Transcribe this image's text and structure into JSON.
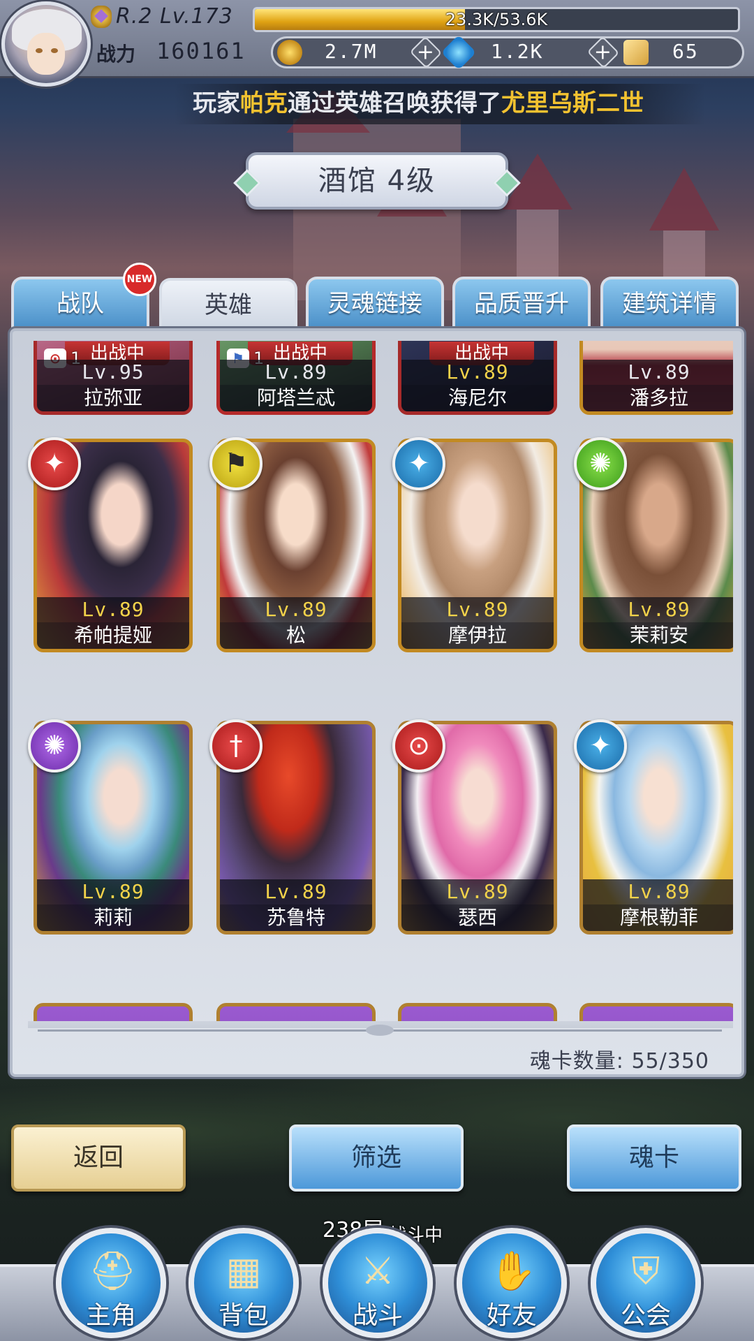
{
  "player": {
    "level_text": "R.2 Lv.173",
    "exp": {
      "current": "23.3K",
      "max": "53.6K",
      "text": "23.3K/53.6K",
      "fraction": 0.435
    },
    "power_label": "战力",
    "power_value": "160161"
  },
  "resources": {
    "gold": "2.7M",
    "diamond": "1.2K",
    "ticket": "65",
    "plus": "+"
  },
  "broadcast": {
    "part1": "玩家",
    "player_name": "帕克",
    "part2": "通过英雄召唤获得了",
    "hero_name": "尤里乌斯二世"
  },
  "building_title": "酒馆 4级",
  "tabs": [
    {
      "label": "战队",
      "badge": "NEW"
    },
    {
      "label": "英雄"
    },
    {
      "label": "灵魂链接"
    },
    {
      "label": "品质晋升"
    },
    {
      "label": "建筑详情"
    }
  ],
  "deployed_label": "出战中",
  "cards_row0": [
    {
      "name": "拉弥亚",
      "level": "Lv.95",
      "count": "1",
      "deployed": true
    },
    {
      "name": "阿塔兰忒",
      "level": "Lv.89",
      "count": "1",
      "deployed": true
    },
    {
      "name": "海尼尔",
      "level": "Lv.89",
      "deployed": true
    },
    {
      "name": "潘多拉",
      "level": "Lv.89"
    }
  ],
  "cards_row1": [
    {
      "name": "希帕提娅",
      "level": "Lv.89",
      "element": "wing-icon"
    },
    {
      "name": "松",
      "level": "Lv.89",
      "element": "banner-icon"
    },
    {
      "name": "摩伊拉",
      "level": "Lv.89",
      "element": "wing-icon"
    },
    {
      "name": "茉莉安",
      "level": "Lv.89",
      "element": "shuriken-icon"
    }
  ],
  "cards_row2": [
    {
      "name": "莉莉",
      "level": "Lv.89",
      "element": "shuriken-icon"
    },
    {
      "name": "苏鲁特",
      "level": "Lv.89",
      "element": "dagger-icon"
    },
    {
      "name": "瑟西",
      "level": "Lv.89",
      "element": "staff-icon"
    },
    {
      "name": "摩根勒菲",
      "level": "Lv.89",
      "element": "wing-icon"
    }
  ],
  "soul_card_count": "魂卡数量: 55/350",
  "buttons": {
    "back": "返回",
    "filter": "筛选",
    "soul_card": "魂卡"
  },
  "floor_info": "238层",
  "battle_status": "战斗中",
  "bottom_nav": [
    {
      "label": "主角",
      "icon": "helmet-icon"
    },
    {
      "label": "背包",
      "icon": "backpack-icon"
    },
    {
      "label": "战斗",
      "icon": "crossed-swords-icon"
    },
    {
      "label": "好友",
      "icon": "handshake-icon"
    },
    {
      "label": "公会",
      "icon": "guild-crest-icon"
    }
  ],
  "colors": {
    "gold_text": "#f3d34a",
    "highlight_text": "#f2c230",
    "tab_blue": "#4a8fc8",
    "badge_red": "#d82a2a"
  }
}
